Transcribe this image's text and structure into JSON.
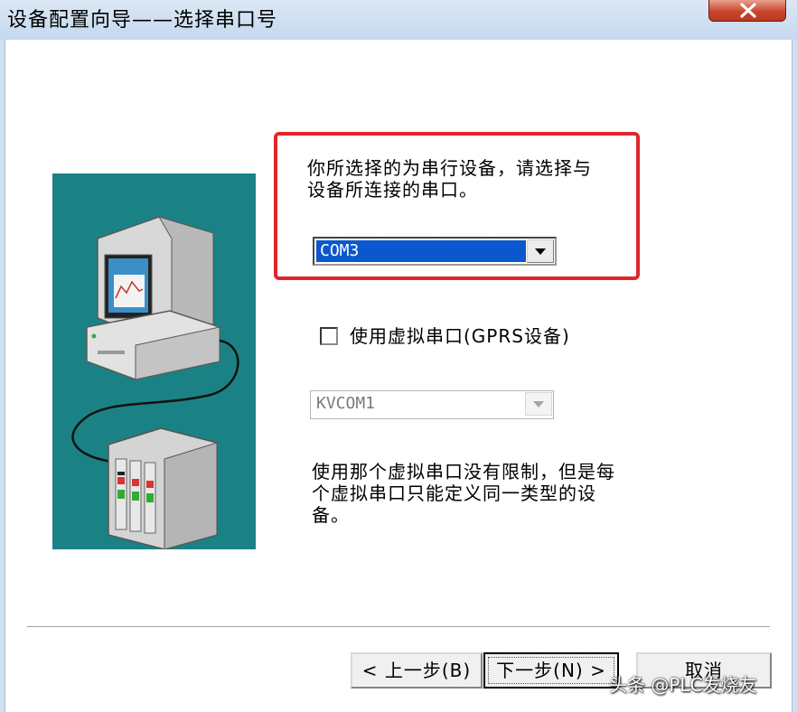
{
  "window": {
    "title": "设备配置向导——选择串口号",
    "close_icon": "close-x-icon"
  },
  "serial": {
    "prompt_line1": "你所选择的为串行设备，请选择与",
    "prompt_line2": "设备所连接的串口。",
    "port_value": "COM3"
  },
  "virtual": {
    "checkbox_label": "使用虚拟串口(GPRS设备)",
    "checked": false,
    "port_value": "KVCOM1",
    "note_line1": "使用那个虚拟串口没有限制，但是每",
    "note_line2": "个虚拟串口只能定义同一类型的设",
    "note_line3": "备。"
  },
  "buttons": {
    "back_label": "< 上一步(B)",
    "next_label": "下一步(N) >",
    "cancel_label": "取消"
  },
  "watermark": "头条 @PLC发烧友",
  "colors": {
    "illustration_bg": "#1a8284",
    "highlight_border": "#e0262b",
    "selection": "#0a58d0"
  }
}
